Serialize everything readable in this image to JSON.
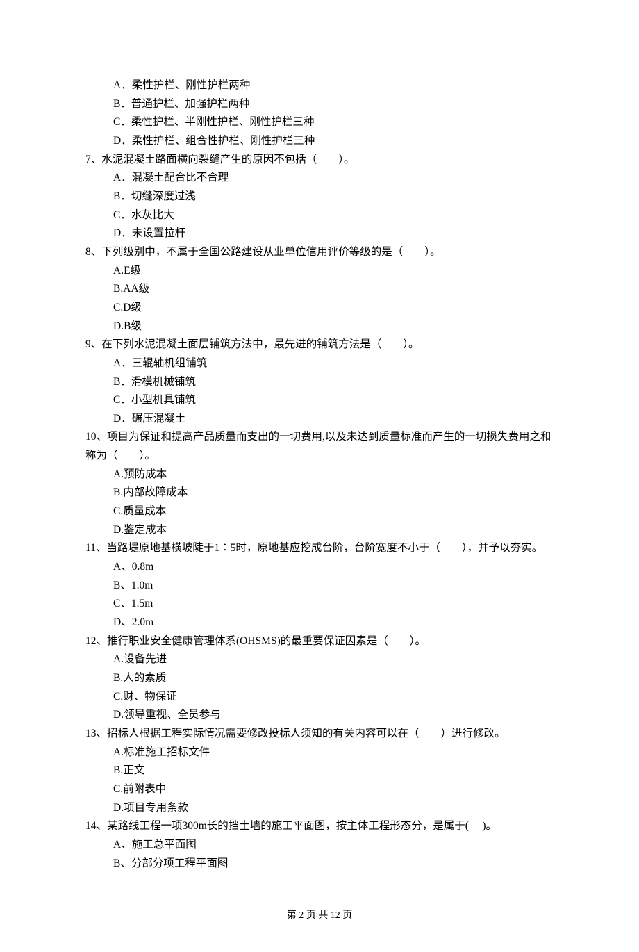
{
  "q6": {
    "optA": "A．柔性护栏、刚性护栏两种",
    "optB": "B．普通护栏、加强护栏两种",
    "optC": "C．柔性护栏、半刚性护栏、刚性护栏三种",
    "optD": "D．柔性护栏、组合性护栏、刚性护栏三种"
  },
  "q7": {
    "text": "7、水泥混凝土路面横向裂缝产生的原因不包括（　　）。",
    "optA": "A．混凝土配合比不合理",
    "optB": "B．切缝深度过浅",
    "optC": "C．水灰比大",
    "optD": "D．未设置拉杆"
  },
  "q8": {
    "text": "8、下列级别中，不属于全国公路建设从业单位信用评价等级的是（　　）。",
    "optA": "A.E级",
    "optB": "B.AA级",
    "optC": "C.D级",
    "optD": "D.B级"
  },
  "q9": {
    "text": "9、在下列水泥混凝土面层铺筑方法中，最先进的铺筑方法是（　　）。",
    "optA": "A．三辊轴机组铺筑",
    "optB": "B．滑模机械铺筑",
    "optC": "C．小型机具铺筑",
    "optD": "D．碾压混凝土"
  },
  "q10": {
    "text": "10、项目为保证和提高产品质量而支出的一切费用,以及未达到质量标准而产生的一切损失费用之和称为（　　）。",
    "optA": "A.预防成本",
    "optB": "B.内部故障成本",
    "optC": "C.质量成本",
    "optD": "D.鉴定成本"
  },
  "q11": {
    "text": "11、当路堤原地基横坡陡于1∶5时，原地基应挖成台阶，台阶宽度不小于（　　），并予以夯实。",
    "optA": "A、0.8m",
    "optB": "B、1.0m",
    "optC": "C、1.5m",
    "optD": "D、2.0m"
  },
  "q12": {
    "text": "12、推行职业安全健康管理体系(OHSMS)的最重要保证因素是（　　）。",
    "optA": "A.设备先进",
    "optB": "B.人的素质",
    "optC": "C.财、物保证",
    "optD": "D.领导重视、全员参与"
  },
  "q13": {
    "text": "13、招标人根据工程实际情况需要修改投标人须知的有关内容可以在（　　）进行修改。",
    "optA": "A.标准施工招标文件",
    "optB": "B.正文",
    "optC": "C.前附表中",
    "optD": "D.项目专用条款"
  },
  "q14": {
    "text": "14、某路线工程一项300m长的挡土墙的施工平面图，按主体工程形态分，是属于(　 )。",
    "optA": "A、施工总平面图",
    "optB": "B、分部分项工程平面图"
  },
  "footer": "第 2 页 共 12 页"
}
